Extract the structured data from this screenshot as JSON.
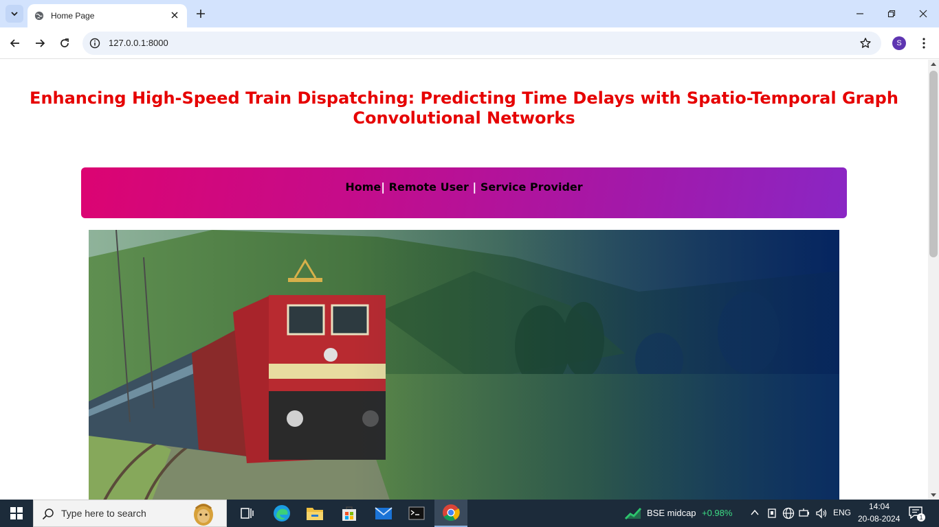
{
  "browser": {
    "tab_title": "Home Page",
    "url": "127.0.0.1:8000",
    "profile_initial": "S"
  },
  "page": {
    "title": "Enhancing High-Speed Train Dispatching: Predicting Time Delays with Spatio-Temporal Graph Convolutional Networks",
    "nav": {
      "home": "Home",
      "remote_user": "Remote User",
      "service_provider": "Service Provider",
      "sep1": "|",
      "sep2": "|"
    },
    "colors": {
      "title": "#e60000",
      "nav_gradient_start": "#dc0472",
      "nav_gradient_end": "#8a26c4"
    }
  },
  "taskbar": {
    "search_placeholder": "Type here to search",
    "stock_name": "BSE midcap",
    "stock_change": "+0.98%",
    "language": "ENG",
    "time": "14:04",
    "date": "20-08-2024",
    "notification_count": "1"
  }
}
